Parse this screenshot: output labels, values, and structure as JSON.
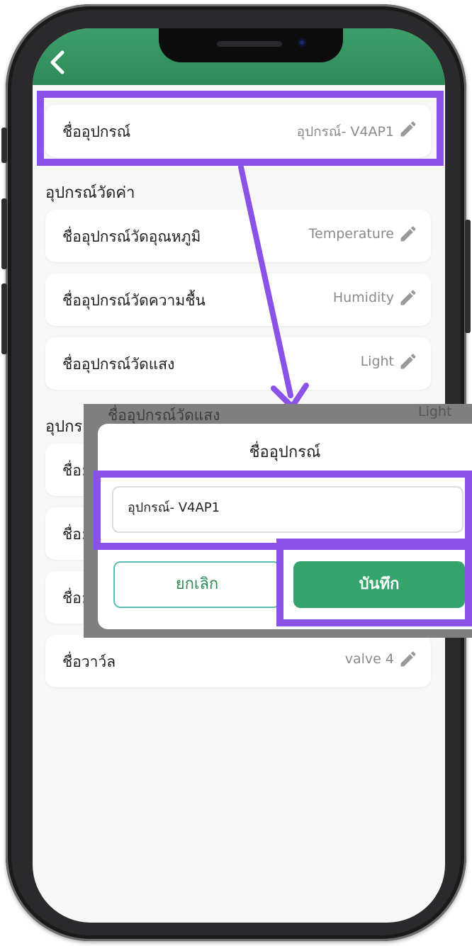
{
  "header": {
    "back_icon": "chevron-left-icon"
  },
  "device_name_row": {
    "label": "ชื่ออุปกรณ์",
    "value": "อุปกรณ์- V4AP1"
  },
  "sections": [
    {
      "title": "อุปกรณ์วัดค่า",
      "rows": [
        {
          "label": "ชื่ออุปกรณ์วัดอุณหภูมิ",
          "value": "Temperature"
        },
        {
          "label": "ชื่ออุปกรณ์วัดความชื้น",
          "value": "Humidity"
        },
        {
          "label": "ชื่ออุปกรณ์วัดแสง",
          "value": "Light"
        }
      ]
    },
    {
      "title": "อุปกร",
      "rows": [
        {
          "label": "ชื่อ:"
        },
        {
          "label": "ชื่อ:"
        },
        {
          "label": "ชื่อ:"
        }
      ]
    }
  ],
  "valve_row": {
    "label": "ชื่อวาว์ล",
    "value": "valve 4"
  },
  "overlay_ghost": {
    "label": "ชื่ออุปกรณ์วัดแสง",
    "value": "Light"
  },
  "dialog": {
    "title": "ชื่ออุปกรณ์",
    "input_value": "อุปกรณ์- V4AP1",
    "cancel_label": "ยกเลิก",
    "save_label": "บันทึก"
  },
  "colors": {
    "accent": "#2e8b57",
    "highlight": "#8a52e6",
    "cancel_border": "#5bbfb2"
  }
}
